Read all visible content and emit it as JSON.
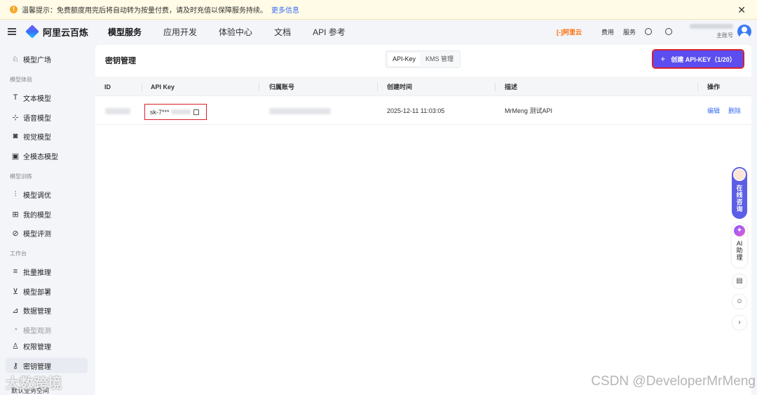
{
  "notice": {
    "text": "温馨提示：免费额度用完后将自动转为按量付费，请及时充值以保障服务持续。",
    "more_link": "更多信息"
  },
  "header": {
    "brand": "阿里云百炼",
    "nav": [
      "模型服务",
      "应用开发",
      "体验中心",
      "文档",
      "API 参考"
    ],
    "aliyun": "[-]阿里云",
    "links": [
      "费用",
      "服务"
    ],
    "account_role": "主账号"
  },
  "sidebar": {
    "model_plaza": "模型广场",
    "section_experience": "模型体验",
    "text_model": "文本模型",
    "voice_model": "语音模型",
    "vision_model": "视觉模型",
    "omni_model": "全模态模型",
    "section_training": "模型训练",
    "tuning": "模型调优",
    "my_models": "我的模型",
    "evaluation": "模型评测",
    "section_workbench": "工作台",
    "batch": "批量推理",
    "deploy": "模型部署",
    "data": "数据管理",
    "observe": "模型观测",
    "permissions": "权限管理",
    "keys": "密钥管理",
    "footer": "默认业务空间"
  },
  "main": {
    "title": "密钥管理",
    "tabs": [
      "API-Key",
      "KMS 管理"
    ],
    "create_button": "创建 API-KEY（1/20）",
    "columns": [
      "ID",
      "API Key",
      "归属账号",
      "创建时间",
      "描述",
      "操作"
    ],
    "rows": [
      {
        "api_key_prefix": "sk-7***",
        "created": "2025-12-11 11:03:05",
        "description": "MrMeng 测试API",
        "actions": [
          "编辑",
          "删除"
        ]
      }
    ]
  },
  "float": {
    "chat": [
      "在",
      "线",
      "咨",
      "询"
    ],
    "ai": [
      "AI",
      "助",
      "理"
    ]
  },
  "watermarks": {
    "left": "大数跨境",
    "right": "CSDN @DeveloperMrMeng"
  },
  "colors": {
    "accent": "#5b4df0",
    "highlight_border": "#d9202b",
    "link": "#3a6cf4"
  }
}
